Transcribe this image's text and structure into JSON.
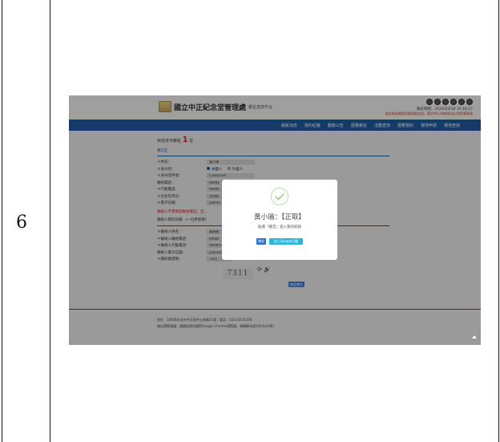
{
  "step_number": "6",
  "site": {
    "name": "國立中正紀念堂管理處",
    "name_sub": "報名查詢平台",
    "header_time": "報名時間：2024/03/18 16:16:27",
    "header_warning": "報名後若需取消請來電告知，請於48小時前取消以免影響資格",
    "nav": [
      "最新消息",
      "我的紀錄",
      "動態公告",
      "展覽報名",
      "活動查詢",
      "展覽預約",
      "場地申請",
      "場地查詢"
    ]
  },
  "form": {
    "count_prefix": "目前本可報名",
    "count_value": "1",
    "count_suffix": "位",
    "tab": "第1位",
    "fields": [
      {
        "label": "＊姓名：",
        "value": "黃小瑜"
      },
      {
        "label": "＊身分別：",
        "radio": [
          "本國人",
          "外國人"
        ]
      },
      {
        "label": "＊身份證字號：",
        "value": "L2xxxxxxx"
      },
      {
        "label": "聯絡電話：",
        "value": "0909x"
      },
      {
        "label": "＊行動電話：",
        "value": "0909x"
      },
      {
        "label": "＊出生年月日：",
        "value": "2008x"
      },
      {
        "label": "＊電子信箱：",
        "value": "joanne"
      }
    ],
    "notice": "聯絡人不需填寫聯絡電話，但...",
    "contact_prefix": "聯絡人資料同報",
    "contact_suffix": "(一位參加者)",
    "contact_fields": [
      {
        "label": "＊聯絡人姓名：",
        "value": "黃筱瑜"
      },
      {
        "label": "＊聯絡人聯絡電話：",
        "value": "0909x"
      },
      {
        "label": "＊聯絡人行動電話：",
        "value": "0909072000"
      },
      {
        "label": "聯絡人電子信箱：",
        "value": "joanne2005x000@gmail.com"
      },
      {
        "label": "＊圖形驗證碼：",
        "value": "7321"
      }
    ],
    "captcha": "7311",
    "submit_label": "確認報名"
  },
  "footer": {
    "line1": "地址：10048台北市中正區中山南路21號｜電話：(02)23431100",
    "line2": "最佳瀏覽建議：請確認使用瀏覽Google Chrome瀏覽器，螢幕解析度1024x1080"
  },
  "modal": {
    "title": "黃小瑜：【正取】",
    "message": "點選「確定」進入我的紀錄",
    "ok_label": "確定",
    "calendar_label": "加入Google日曆"
  }
}
